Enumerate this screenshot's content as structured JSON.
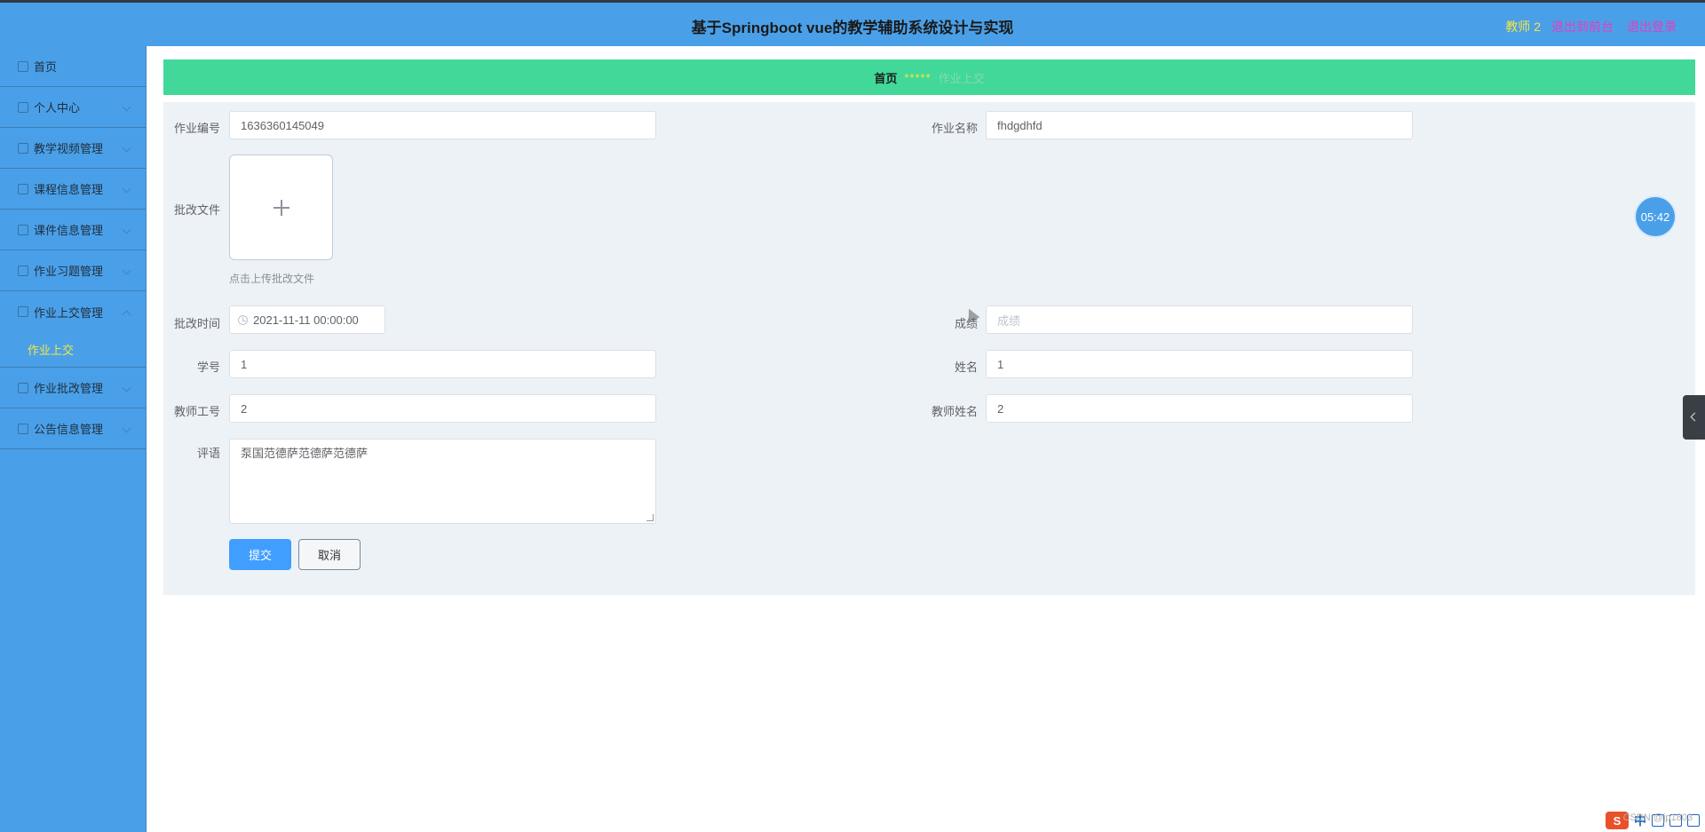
{
  "header": {
    "title": "基于Springboot vue的教学辅助系统设计与实现",
    "user_label": "教师 2",
    "back_label": "退出到前台",
    "logout_label": "退出登录",
    "colors": {
      "bar": "#4aa0e8",
      "user": "#f5e642",
      "links": "#e040c0"
    }
  },
  "sidebar": {
    "items": [
      {
        "label": "首页",
        "icon": "home-icon"
      },
      {
        "label": "个人中心",
        "icon": "user-icon"
      },
      {
        "label": "教学视频管理",
        "icon": "video-icon"
      },
      {
        "label": "课程信息管理",
        "icon": "book-icon"
      },
      {
        "label": "课件信息管理",
        "icon": "file-icon"
      },
      {
        "label": "作业习题管理",
        "icon": "exercise-icon"
      },
      {
        "label": "作业上交管理",
        "icon": "upload-icon"
      },
      {
        "label": "作业批改管理",
        "icon": "grade-icon"
      },
      {
        "label": "公告信息管理",
        "icon": "notice-icon"
      }
    ],
    "submenu": {
      "label": "作业上交",
      "color": "#f5e642"
    }
  },
  "breadcrumb": {
    "home": "首页",
    "separator": "*****",
    "current": "作业上交"
  },
  "form": {
    "homework_no": {
      "label": "作业编号",
      "value": "1636360145049"
    },
    "homework_name": {
      "label": "作业名称",
      "value": "fhdgdhfd"
    },
    "review_file": {
      "label": "批改文件",
      "tip": "点击上传批改文件"
    },
    "review_time": {
      "label": "批改时间",
      "value": "2021-11-11 00:00:00"
    },
    "score": {
      "label": "成绩",
      "placeholder": "成绩"
    },
    "student_no": {
      "label": "学号",
      "value": "1"
    },
    "student_name": {
      "label": "姓名",
      "value": "1"
    },
    "teacher_no": {
      "label": "教师工号",
      "value": "2"
    },
    "teacher_name": {
      "label": "教师姓名",
      "value": "2"
    },
    "comment": {
      "label": "评语",
      "value": "泵国范德萨范德萨范德萨"
    },
    "submit_label": "提交",
    "cancel_label": "取消"
  },
  "overlay": {
    "timer": "05:42",
    "tray_text": "中",
    "watermark": "CSDN @jp1803"
  }
}
